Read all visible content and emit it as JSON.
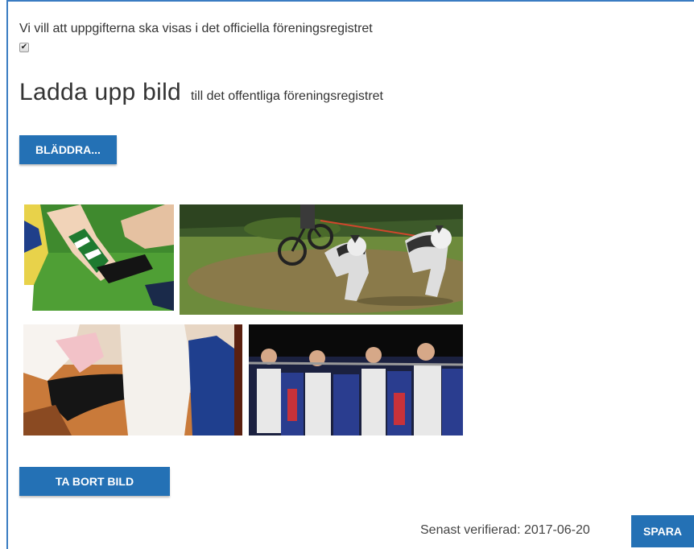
{
  "consent": {
    "label": "Vi vill att uppgifterna ska visas i det officiella föreningsregistret",
    "checked": true
  },
  "upload": {
    "title": "Ladda upp bild",
    "subtitle": "till det offentliga föreningsregistret",
    "browse_label": "BLÄDDRA...",
    "remove_label": "TA BORT BILD"
  },
  "footer": {
    "verified_text": "Senast verifierad: 2017-06-20",
    "save_label": "SPARA"
  },
  "colors": {
    "accent": "#2471b5",
    "frame_border": "#3a7cc2"
  }
}
